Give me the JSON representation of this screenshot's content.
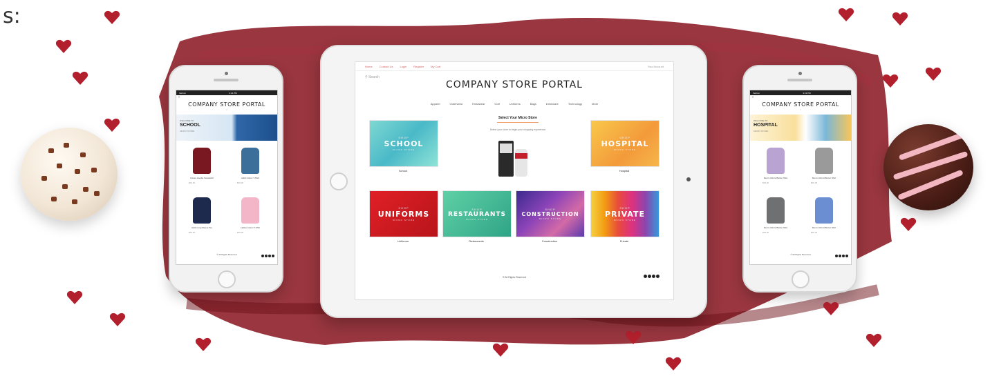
{
  "corner_text": "s:",
  "tablet": {
    "topbar_links": [
      "Home",
      "Contact Us",
      "Login",
      "Register",
      "My Cart"
    ],
    "account_text": "Your Account",
    "search_label": "Search",
    "logo": "COMPANY STORE PORTAL",
    "nav": [
      "Apparel",
      "Outerwear",
      "Headwear",
      "Golf",
      "Uniforms",
      "Bags",
      "Drinkware",
      "Technology",
      "More"
    ],
    "select_title": "Select Your Micro Store",
    "select_subtitle": "Select your store to begin your shopping experience",
    "tiles": [
      {
        "shop": "SHOP",
        "label": "SCHOOL",
        "sub": "MICRO STORE",
        "caption": "School"
      },
      {
        "shop": "SHOP",
        "label": "HOSPITAL",
        "sub": "MICRO STORE",
        "caption": "Hospital"
      },
      {
        "shop": "SHOP",
        "label": "UNIFORMS",
        "sub": "MICRO STORE",
        "caption": "Uniforms"
      },
      {
        "shop": "SHOP",
        "label": "RESTAURANTS",
        "sub": "MICRO STORE",
        "caption": "Restaurants"
      },
      {
        "shop": "SHOP",
        "label": "CONSTRUCTION",
        "sub": "MICRO STORE",
        "caption": "Construction"
      },
      {
        "shop": "SHOP",
        "label": "PRIVATE",
        "sub": "MICRO STORE",
        "caption": "Private"
      }
    ],
    "footer": "© All Rights Reserved"
  },
  "phone_left": {
    "carrier": "Verizon",
    "time": "4:21 PM",
    "logo": "COMPANY STORE PORTAL",
    "banner_small": "WELCOME TO",
    "banner_title": "SCHOOL",
    "banner_sub": "MICRO STORE",
    "items": [
      {
        "name": "Unisex Hoodie Sweatshirt",
        "price": "$00.00",
        "color": "#7a1822"
      },
      {
        "name": "Adult Cotton T-Shirt",
        "price": "$00.00",
        "color": "#3d6f9b"
      },
      {
        "name": "Adult Long Sleeve Tee",
        "price": "$00.00",
        "color": "#1d2a4e"
      },
      {
        "name": "Ladies Cotton T-Shirt",
        "price": "$00.00",
        "color": "#f2b6c8"
      }
    ],
    "footer": "© All Rights Reserved"
  },
  "phone_right": {
    "carrier": "Verizon",
    "time": "4:21 PM",
    "logo": "COMPANY STORE PORTAL",
    "banner_small": "WELCOME TO",
    "banner_title": "HOSPITAL",
    "banner_sub": "MICRO STORE",
    "items": [
      {
        "name": "Men's Oxford Button Shirt",
        "price": "$00.00",
        "color": "#b9a3d2"
      },
      {
        "name": "Men's Oxford Button Shirt",
        "price": "$00.00",
        "color": "#9a9a9a"
      },
      {
        "name": "Men's Oxford Button Shirt",
        "price": "$00.00",
        "color": "#6e7072"
      },
      {
        "name": "Men's Oxford Button Shirt",
        "price": "$00.00",
        "color": "#6a8ed1"
      }
    ],
    "footer": "© All Rights Reserved"
  },
  "colors": {
    "brush": "#8b1a24",
    "heart": "#b3202d",
    "school": "#5ac8c8",
    "hospital": "#f6a93a",
    "uniforms": "#c8161d",
    "restaurants": "#41b990",
    "construction": "#7a3ea8",
    "private": "#e23d8a"
  }
}
